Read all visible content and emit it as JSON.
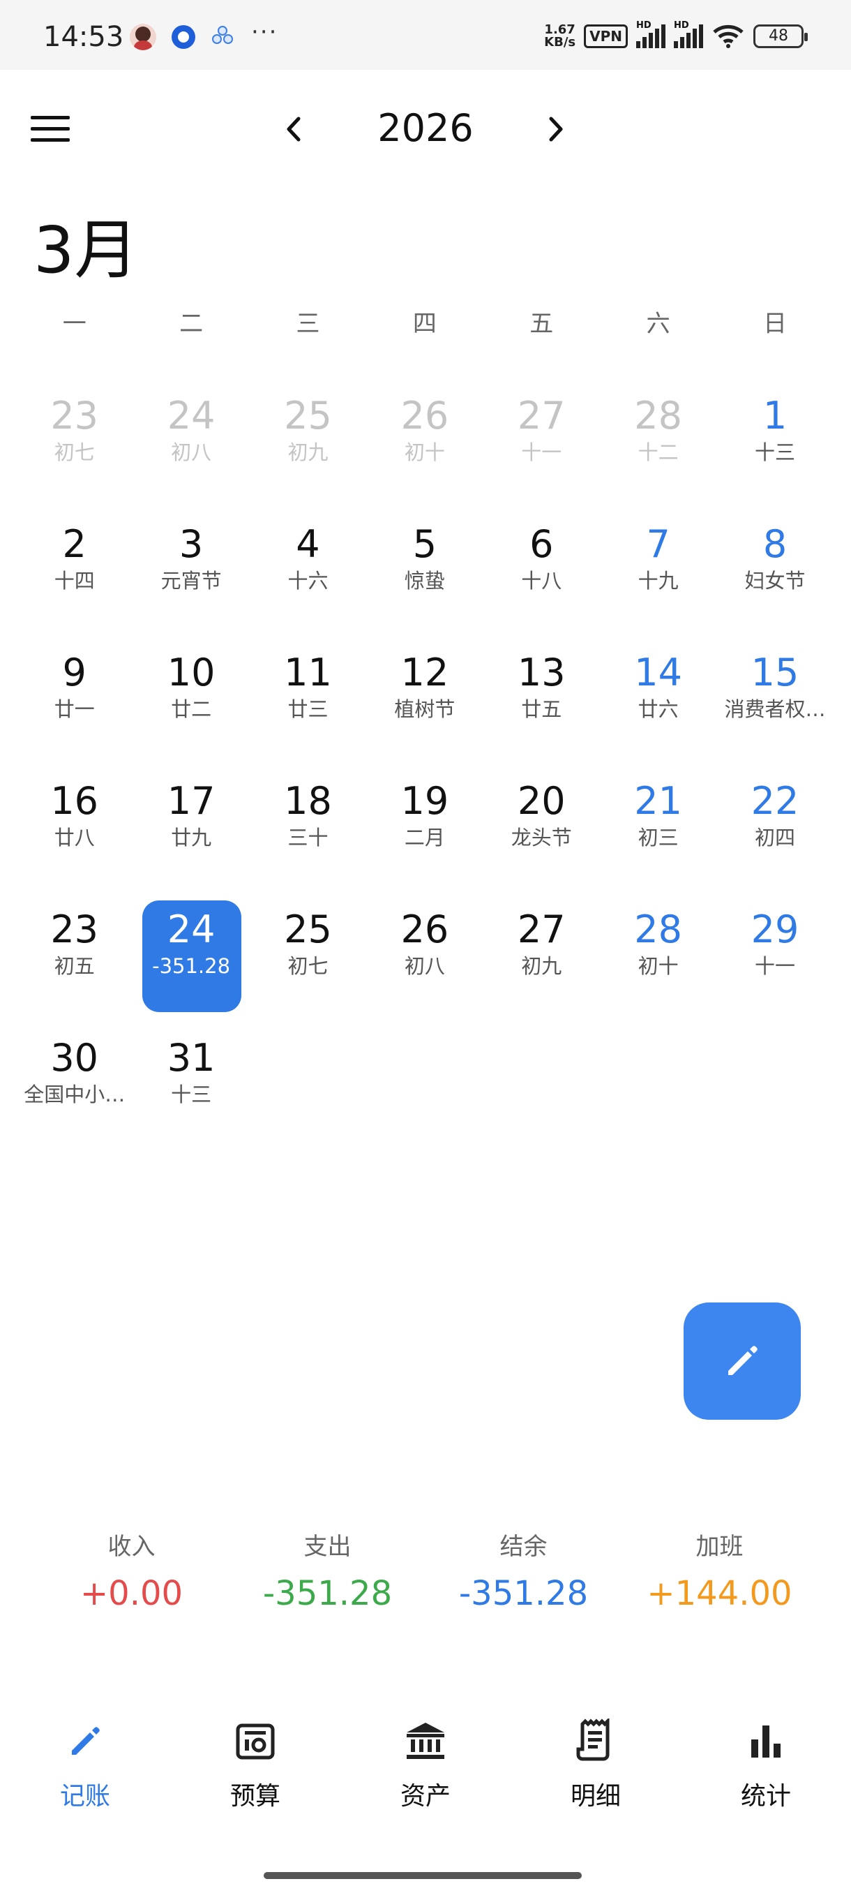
{
  "status_bar": {
    "time": "14:53",
    "more": "···",
    "speed_top": "1.67",
    "speed_bottom": "KB/s",
    "vpn": "VPN",
    "hd1": "HD",
    "hd2": "HD",
    "battery": "48"
  },
  "header": {
    "year": "2026",
    "month": "3月",
    "menu_icon": "menu-icon",
    "prev_icon": "chevron-left-icon",
    "next_icon": "chevron-right-icon"
  },
  "weekdays": [
    "一",
    "二",
    "三",
    "四",
    "五",
    "六",
    "日"
  ],
  "days": [
    {
      "num": "23",
      "sub": "初七",
      "type": "other"
    },
    {
      "num": "24",
      "sub": "初八",
      "type": "other"
    },
    {
      "num": "25",
      "sub": "初九",
      "type": "other"
    },
    {
      "num": "26",
      "sub": "初十",
      "type": "other"
    },
    {
      "num": "27",
      "sub": "十一",
      "type": "other"
    },
    {
      "num": "28",
      "sub": "十二",
      "type": "other"
    },
    {
      "num": "1",
      "sub": "十三",
      "type": "weekend"
    },
    {
      "num": "2",
      "sub": "十四",
      "type": "normal"
    },
    {
      "num": "3",
      "sub": "元宵节",
      "type": "normal"
    },
    {
      "num": "4",
      "sub": "十六",
      "type": "normal"
    },
    {
      "num": "5",
      "sub": "惊蛰",
      "type": "normal"
    },
    {
      "num": "6",
      "sub": "十八",
      "type": "normal"
    },
    {
      "num": "7",
      "sub": "十九",
      "type": "weekend"
    },
    {
      "num": "8",
      "sub": "妇女节",
      "type": "weekend"
    },
    {
      "num": "9",
      "sub": "廿一",
      "type": "normal"
    },
    {
      "num": "10",
      "sub": "廿二",
      "type": "normal"
    },
    {
      "num": "11",
      "sub": "廿三",
      "type": "normal"
    },
    {
      "num": "12",
      "sub": "植树节",
      "type": "normal"
    },
    {
      "num": "13",
      "sub": "廿五",
      "type": "normal"
    },
    {
      "num": "14",
      "sub": "廿六",
      "type": "weekend"
    },
    {
      "num": "15",
      "sub": "消费者权…",
      "type": "weekend"
    },
    {
      "num": "16",
      "sub": "廿八",
      "type": "normal"
    },
    {
      "num": "17",
      "sub": "廿九",
      "type": "normal"
    },
    {
      "num": "18",
      "sub": "三十",
      "type": "normal"
    },
    {
      "num": "19",
      "sub": "二月",
      "type": "normal"
    },
    {
      "num": "20",
      "sub": "龙头节",
      "type": "normal"
    },
    {
      "num": "21",
      "sub": "初三",
      "type": "weekend"
    },
    {
      "num": "22",
      "sub": "初四",
      "type": "weekend"
    },
    {
      "num": "23",
      "sub": "初五",
      "type": "normal"
    },
    {
      "num": "24",
      "sub": "-351.28",
      "type": "selected"
    },
    {
      "num": "25",
      "sub": "初七",
      "type": "normal"
    },
    {
      "num": "26",
      "sub": "初八",
      "type": "normal"
    },
    {
      "num": "27",
      "sub": "初九",
      "type": "normal"
    },
    {
      "num": "28",
      "sub": "初十",
      "type": "weekend"
    },
    {
      "num": "29",
      "sub": "十一",
      "type": "weekend"
    },
    {
      "num": "30",
      "sub": "全国中小…",
      "type": "normal"
    },
    {
      "num": "31",
      "sub": "十三",
      "type": "normal"
    }
  ],
  "fab": {
    "icon": "pencil-icon"
  },
  "summary": [
    {
      "label": "收入",
      "value": "+0.00",
      "color": "#e54b4b"
    },
    {
      "label": "支出",
      "value": "-351.28",
      "color": "#3caa4a"
    },
    {
      "label": "结余",
      "value": "-351.28",
      "color": "#2f7ae5"
    },
    {
      "label": "加班",
      "value": "+144.00",
      "color": "#f39a1e"
    }
  ],
  "nav": [
    {
      "label": "记账",
      "icon": "pencil-icon",
      "active": true
    },
    {
      "label": "预算",
      "icon": "budget-icon",
      "active": false
    },
    {
      "label": "资产",
      "icon": "bank-icon",
      "active": false
    },
    {
      "label": "明细",
      "icon": "receipt-icon",
      "active": false
    },
    {
      "label": "统计",
      "icon": "bar-chart-icon",
      "active": false
    }
  ],
  "colors": {
    "accent": "#2f7ae5",
    "fab": "#3d86ef"
  }
}
